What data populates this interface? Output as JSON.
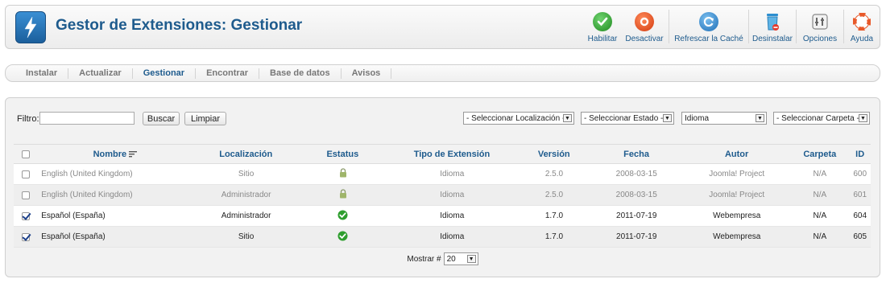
{
  "header": {
    "title": "Gestor de Extensiones: Gestionar",
    "toolbar": [
      {
        "label": "Habilitar",
        "icon": "check-circle-icon",
        "color": "#2e9e2e"
      },
      {
        "label": "Desactivar",
        "icon": "stop-circle-icon",
        "color": "#e04a1a"
      },
      {
        "label": "Refrescar la Caché",
        "icon": "refresh-icon",
        "color": "#2c7fc8"
      },
      {
        "label": "Desinstalar",
        "icon": "trash-icon",
        "color": "#3a9ad6"
      },
      {
        "label": "Opciones",
        "icon": "options-icon",
        "color": "#8a8a8a"
      },
      {
        "label": "Ayuda",
        "icon": "lifebuoy-icon",
        "color": "#e8592a"
      }
    ]
  },
  "tabs": [
    "Instalar",
    "Actualizar",
    "Gestionar",
    "Encontrar",
    "Base de datos",
    "Avisos"
  ],
  "active_tab": "Gestionar",
  "filter": {
    "label": "Filtro:",
    "value": "",
    "search_button": "Buscar",
    "clear_button": "Limpiar",
    "selects": [
      "- Seleccionar Localización -",
      "- Seleccionar Estado -",
      "Idioma",
      "- Seleccionar Carpeta -"
    ]
  },
  "table": {
    "columns": [
      "Nombre",
      "Localización",
      "Estatus",
      "Tipo de Extensión",
      "Versión",
      "Fecha",
      "Autor",
      "Carpeta",
      "ID"
    ],
    "rows": [
      {
        "checked": false,
        "name": "English (United Kingdom)",
        "location": "Sitio",
        "status": "locked",
        "type": "Idioma",
        "version": "2.5.0",
        "date": "2008-03-15",
        "author": "Joomla! Project",
        "folder": "N/A",
        "id": "600"
      },
      {
        "checked": false,
        "name": "English (United Kingdom)",
        "location": "Administrador",
        "status": "locked",
        "type": "Idioma",
        "version": "2.5.0",
        "date": "2008-03-15",
        "author": "Joomla! Project",
        "folder": "N/A",
        "id": "601"
      },
      {
        "checked": true,
        "name": "Español (España)",
        "location": "Administrador",
        "status": "enabled",
        "type": "Idioma",
        "version": "1.7.0",
        "date": "2011-07-19",
        "author": "Webempresa",
        "folder": "N/A",
        "id": "604"
      },
      {
        "checked": true,
        "name": "Español (España)",
        "location": "Sitio",
        "status": "enabled",
        "type": "Idioma",
        "version": "1.7.0",
        "date": "2011-07-19",
        "author": "Webempresa",
        "folder": "N/A",
        "id": "605"
      }
    ]
  },
  "pagination": {
    "label": "Mostrar #",
    "value": "20"
  }
}
